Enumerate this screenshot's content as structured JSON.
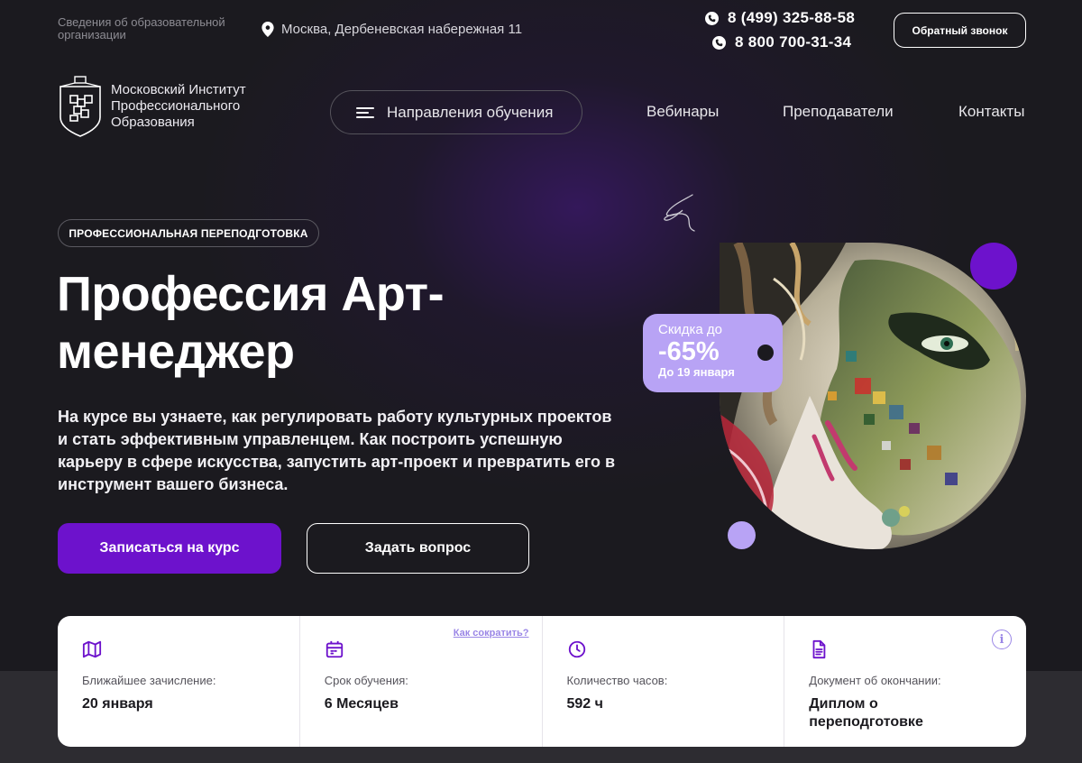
{
  "topbar": {
    "org_info": "Сведения об образовательной организации",
    "address": "Москва, Дербеневская набережная 11",
    "phones": [
      "8 (499) 325-88-58",
      "8 800 700-31-34"
    ],
    "callback_label": "Обратный звонок"
  },
  "header": {
    "logo_text": "Московский Институт Профессионального Образования",
    "directions_label": "Направления обучения",
    "nav": [
      "Вебинары",
      "Преподаватели",
      "Контакты"
    ]
  },
  "hero": {
    "badge": "ПРОФЕССИОНАЛЬНАЯ ПЕРЕПОДГОТОВКА",
    "title": "Профессия Арт-менеджер",
    "description": "На курсе вы узнаете, как регулировать работу культурных проектов и стать эффективным управленцем. Как построить успешную карьеру в сфере искусства, запустить арт-проект и превратить его в инструмент вашего бизнеса.",
    "primary_button": "Записаться на курс",
    "secondary_button": "Задать вопрос"
  },
  "discount": {
    "line1": "Скидка до",
    "value": "-65%",
    "until": "До 19 января"
  },
  "info": {
    "items": [
      {
        "icon": "map-icon",
        "label": "Ближайшее зачисление:",
        "value": "20 января"
      },
      {
        "icon": "calendar-icon",
        "label": "Срок обучения:",
        "value": "6 Месяцев",
        "link": "Как сократить?"
      },
      {
        "icon": "clock-icon",
        "label": "Количество часов:",
        "value": "592 ч"
      },
      {
        "icon": "document-icon",
        "label": "Документ об окончании:",
        "value": "Диплом о переподготовке"
      }
    ],
    "info_icon": "i"
  },
  "colors": {
    "accent": "#6d12cc",
    "lilac": "#b8a3f5",
    "background": "#1b1a1f"
  }
}
